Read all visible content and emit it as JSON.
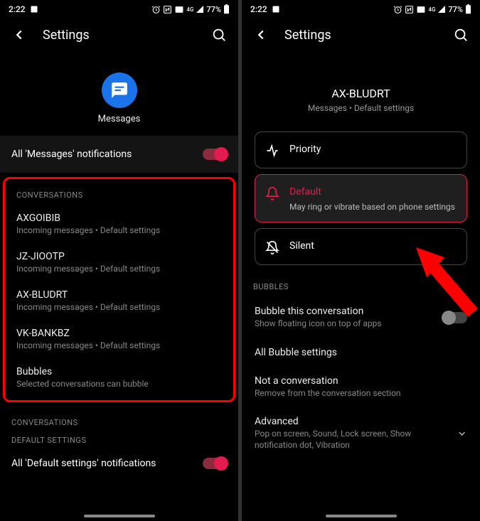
{
  "status": {
    "time": "2:22",
    "battery": "77%",
    "signal": "4G"
  },
  "left": {
    "header_title": "Settings",
    "app_name": "Messages",
    "all_notifications_label": "All 'Messages' notifications",
    "conversations_label": "CONVERSATIONS",
    "conversations": [
      {
        "name": "AXGOIBIB",
        "sub": "Incoming messages • Default settings"
      },
      {
        "name": "JZ-JIOOTP",
        "sub": "Incoming messages • Default settings"
      },
      {
        "name": "AX-BLUDRT",
        "sub": "Incoming messages • Default settings"
      },
      {
        "name": "VK-BANKBZ",
        "sub": "Incoming messages • Default settings"
      }
    ],
    "bubbles_label": "Bubbles",
    "bubbles_sub": "Selected conversations can bubble",
    "conversations_label2": "CONVERSATIONS",
    "default_settings_label": "DEFAULT SETTINGS",
    "all_default_label": "All 'Default settings' notifications"
  },
  "right": {
    "header_title": "Settings",
    "conv_name": "AX-BLUDRT",
    "conv_sub": "Messages • Default settings",
    "priority_label": "Priority",
    "default_label": "Default",
    "default_sub": "May ring or vibrate based on phone settings",
    "silent_label": "Silent",
    "bubbles_section": "BUBBLES",
    "bubble_this": "Bubble this conversation",
    "bubble_this_sub": "Show floating icon on top of apps",
    "all_bubble": "All Bubble settings",
    "not_conv": "Not a conversation",
    "not_conv_sub": "Remove from the conversation section",
    "advanced": "Advanced",
    "advanced_sub": "Pop on screen, Sound, Lock screen, Show notification dot, Vibration"
  }
}
